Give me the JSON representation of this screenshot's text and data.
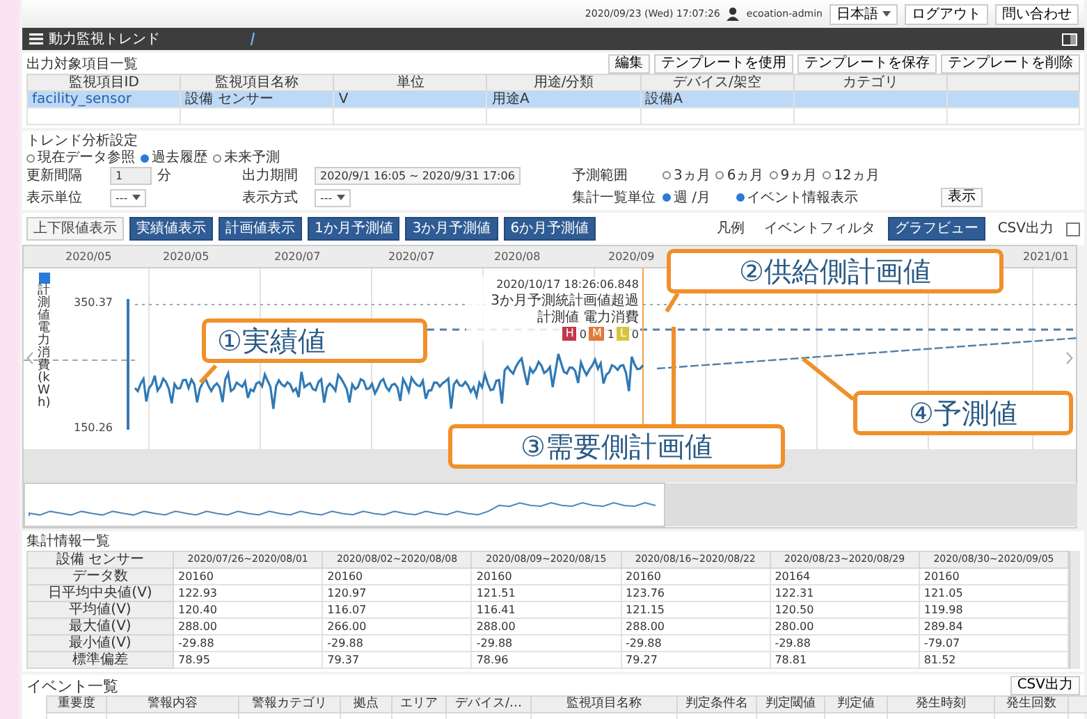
{
  "topbar": {
    "datetime": "2020/09/23 (Wed) 17:07:26",
    "user": "ecoation-admin",
    "language": "日本語",
    "logout": "ログアウト",
    "contact": "問い合わせ"
  },
  "titlebar": {
    "title": "動力監視トレンド"
  },
  "output_items": {
    "title": "出力対象項目一覧",
    "buttons": [
      "編集",
      "テンプレートを使用",
      "テンプレートを保存",
      "テンプレートを削除"
    ],
    "columns": [
      "監視項目ID",
      "監視項目名称",
      "単位",
      "用途/分類",
      "デバイス/架空",
      "カテゴリ"
    ],
    "rows": [
      {
        "cells": [
          "facility_sensor",
          "設備 センサー",
          "V",
          "用途A",
          "設備A",
          ""
        ],
        "selected": true
      }
    ]
  },
  "trend_settings": {
    "title": "トレンド分析設定",
    "modes": [
      {
        "label": "現在データ参照",
        "selected": false
      },
      {
        "label": "過去履歴",
        "selected": true
      },
      {
        "label": "未来予測",
        "selected": false
      }
    ],
    "interval_label": "更新間隔",
    "interval_value": "1",
    "interval_unit": "分",
    "period_label": "出力期間",
    "period_value": "2020/9/1 16:05 ~ 2020/9/31 17:06",
    "range_label": "予測範囲",
    "ranges": [
      {
        "label": "3ヵ月",
        "selected": false
      },
      {
        "label": "6ヵ月",
        "selected": false
      },
      {
        "label": "9ヵ月",
        "selected": false
      },
      {
        "label": "12ヵ月",
        "selected": false
      }
    ],
    "unit_label": "表示単位",
    "unit_value": "---",
    "method_label": "表示方式",
    "method_value": "---",
    "summary_label": "集計一覧単位",
    "summary_units": [
      {
        "label": "週 /月",
        "selected": true
      }
    ],
    "event_info": {
      "label": "イベント情報表示",
      "checked": true
    },
    "show_button": "表示"
  },
  "toolbar": {
    "left": [
      {
        "label": "上下限値表示",
        "kind": "plain"
      },
      {
        "label": "実績値表示",
        "kind": "primary"
      },
      {
        "label": "計画値表示",
        "kind": "primary"
      },
      {
        "label": "1か月予測値",
        "kind": "primary"
      },
      {
        "label": "3か月予測値",
        "kind": "primary"
      },
      {
        "label": "6か月予測値",
        "kind": "primary"
      }
    ],
    "right": [
      {
        "label": "凡例",
        "selected": false
      },
      {
        "label": "イベントフィルタ",
        "selected": false
      },
      {
        "label": "グラフビュー",
        "selected": true
      },
      {
        "label": "CSV出力",
        "selected": false
      }
    ],
    "checkbox": {
      "checked": false
    }
  },
  "chart": {
    "x_labels": [
      "2020/05",
      "2020/05",
      "2020/07",
      "2020/07",
      "2020/08",
      "2020/09",
      "2021/01"
    ],
    "y_max": "350.37",
    "y_min": "150.26",
    "legend": {
      "label": "計測値電力消費(kWh)",
      "checked": true
    },
    "tooltip": {
      "time": "2020/10/17 18:26:06.848",
      "lines": [
        "3か月予測統計画値超過",
        "計測値 電力消費"
      ],
      "levels": [
        {
          "code": "H",
          "count": "0",
          "color": "#c0394b"
        },
        {
          "code": "M",
          "count": "1",
          "color": "#e07a3a"
        },
        {
          "code": "L",
          "count": "0",
          "color": "#d8c43a"
        }
      ]
    },
    "callouts": [
      "①実績値",
      "②供給側計画値",
      "③需要側計画値",
      "④予測値"
    ]
  },
  "summary": {
    "title": "集計情報一覧",
    "header": [
      "設備 センサー",
      "2020/07/26~2020/08/01",
      "2020/08/02~2020/08/08",
      "2020/08/09~2020/08/15",
      "2020/08/16~2020/08/22",
      "2020/08/23~2020/08/29",
      "2020/08/30~2020/09/05"
    ],
    "rows": [
      {
        "label": "データ数",
        "values": [
          "20160",
          "20160",
          "20160",
          "20160",
          "20164",
          "20160"
        ]
      },
      {
        "label": "日平均中央値(V)",
        "values": [
          "122.93",
          "120.97",
          "121.51",
          "123.76",
          "122.31",
          "121.05"
        ]
      },
      {
        "label": "平均値(V)",
        "values": [
          "120.40",
          "116.07",
          "116.41",
          "121.15",
          "120.50",
          "119.98"
        ]
      },
      {
        "label": "最大値(V)",
        "values": [
          "288.00",
          "266.00",
          "288.00",
          "288.00",
          "280.00",
          "289.84"
        ]
      },
      {
        "label": "最小値(V)",
        "values": [
          "-29.88",
          "-29.88",
          "-29.88",
          "-29.88",
          "-29.88",
          "-79.07"
        ]
      },
      {
        "label": "標準偏差",
        "values": [
          "78.95",
          "79.37",
          "78.96",
          "79.27",
          "78.81",
          "81.52"
        ]
      }
    ]
  },
  "events": {
    "title": "イベント一覧",
    "csv_button": "CSV出力",
    "columns": [
      "重要度",
      "警報内容",
      "警報カテゴリ",
      "拠点",
      "エリア",
      "デバイス/…",
      "監視項目名称",
      "判定条件名",
      "判定閾値",
      "判定値",
      "発生時刻",
      "発生回数"
    ]
  }
}
